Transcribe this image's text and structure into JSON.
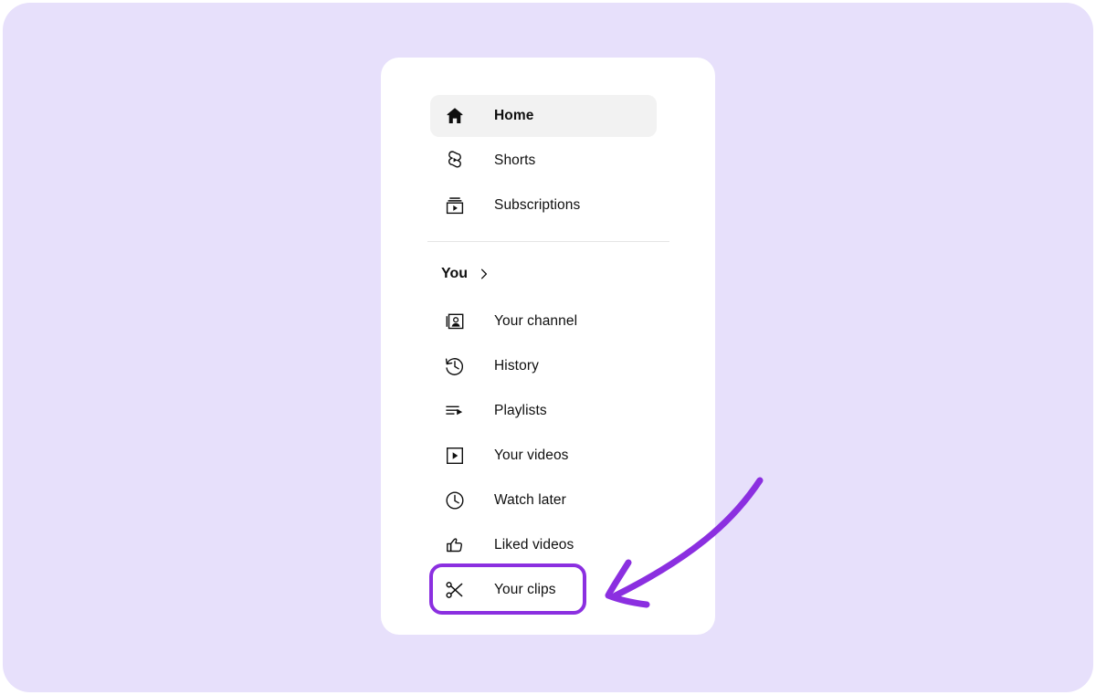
{
  "theme": {
    "page_background": "#ffffff",
    "backdrop_color": "#e7e0fb",
    "card_color": "#ffffff",
    "active_row_color": "#f2f2f2",
    "text_color": "#0f0f0f",
    "annotation_color": "#8b2fe0",
    "divider_color": "#e5e5e5"
  },
  "sidebar": {
    "primary": [
      {
        "label": "Home",
        "icon": "home-icon",
        "active": true
      },
      {
        "label": "Shorts",
        "icon": "shorts-icon",
        "active": false
      },
      {
        "label": "Subscriptions",
        "icon": "subscriptions-icon",
        "active": false
      }
    ],
    "you_section": {
      "title": "You",
      "chevron": "chevron-right-icon",
      "items": [
        {
          "label": "Your channel",
          "icon": "your-channel-icon"
        },
        {
          "label": "History",
          "icon": "history-icon"
        },
        {
          "label": "Playlists",
          "icon": "playlists-icon"
        },
        {
          "label": "Your videos",
          "icon": "your-videos-icon"
        },
        {
          "label": "Watch later",
          "icon": "watch-later-icon"
        },
        {
          "label": "Liked videos",
          "icon": "liked-videos-icon"
        },
        {
          "label": "Your clips",
          "icon": "your-clips-icon"
        }
      ]
    }
  },
  "annotation": {
    "highlight_target": "Your clips",
    "shape": "rounded-rectangle-outline",
    "arrow": "curved-arrow-pointing-left",
    "color": "#8b2fe0"
  }
}
